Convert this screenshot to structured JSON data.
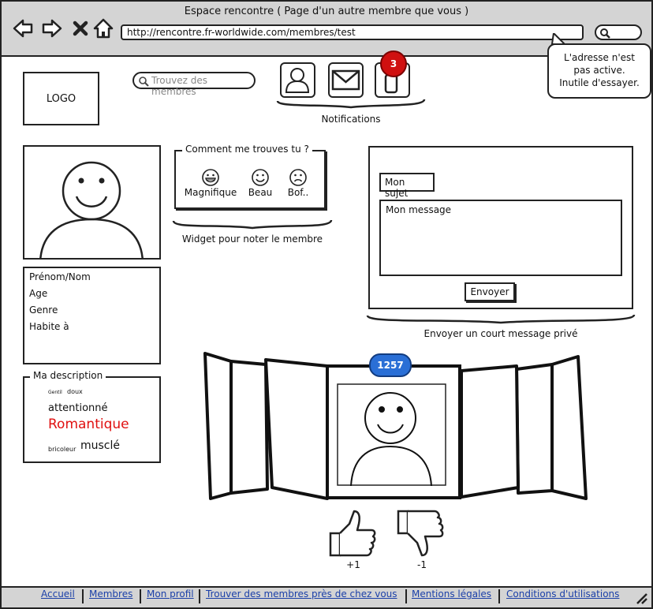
{
  "window": {
    "title": "Espace rencontre ( Page d'un autre membre que vous )"
  },
  "browser": {
    "url": "http://rencontre.fr-worldwide.com/membres/test",
    "tooltip": [
      "L'adresse n'est",
      "pas active.",
      "Inutile d'essayer."
    ]
  },
  "header": {
    "logo": "LOGO",
    "search_placeholder": "Trouvez des membres",
    "notifications_label": "Notifications",
    "notification_count": "3"
  },
  "profile": {
    "fields": [
      "Prénom/Nom",
      "Age",
      "Genre",
      "Habite à"
    ]
  },
  "description": {
    "legend": "Ma description",
    "tags": [
      {
        "text": "Gentil",
        "color": "#111111"
      },
      {
        "text": "doux",
        "color": "#111111"
      },
      {
        "text": "attentionné",
        "color": "#111111"
      },
      {
        "text": "Romantique",
        "color": "#e01010"
      },
      {
        "text": "bricoleur",
        "color": "#111111"
      },
      {
        "text": "musclé",
        "color": "#111111"
      }
    ]
  },
  "rating": {
    "legend": "Comment me trouves tu ?",
    "options": [
      "Magnifique",
      "Beau",
      "Bof.."
    ],
    "caption": "Widget pour noter le membre"
  },
  "message": {
    "subject": "Mon sujet",
    "body": "Mon message",
    "send": "Envoyer",
    "caption": "Envoyer un court message privé"
  },
  "gallery": {
    "count": "1257",
    "like": "+1",
    "dislike": "-1"
  },
  "footer": {
    "links": [
      "Accueil",
      "Membres",
      "Mon profil",
      "Trouver des membres près de chez vous",
      "Mentions légales",
      "Conditions d'utilisations"
    ]
  },
  "colors": {
    "chrome": "#d4d4d4",
    "badge_red": "#d01010",
    "badge_blue": "#2a6fd6",
    "link": "#1a3fa8",
    "accent_tag": "#e01010"
  },
  "icons": [
    "back-icon",
    "forward-icon",
    "stop-icon",
    "home-icon",
    "search-icon",
    "user-icon",
    "mail-icon",
    "phone-icon",
    "smile-icon",
    "thumbs-up-icon",
    "thumbs-down-icon",
    "resize-grip-icon"
  ]
}
